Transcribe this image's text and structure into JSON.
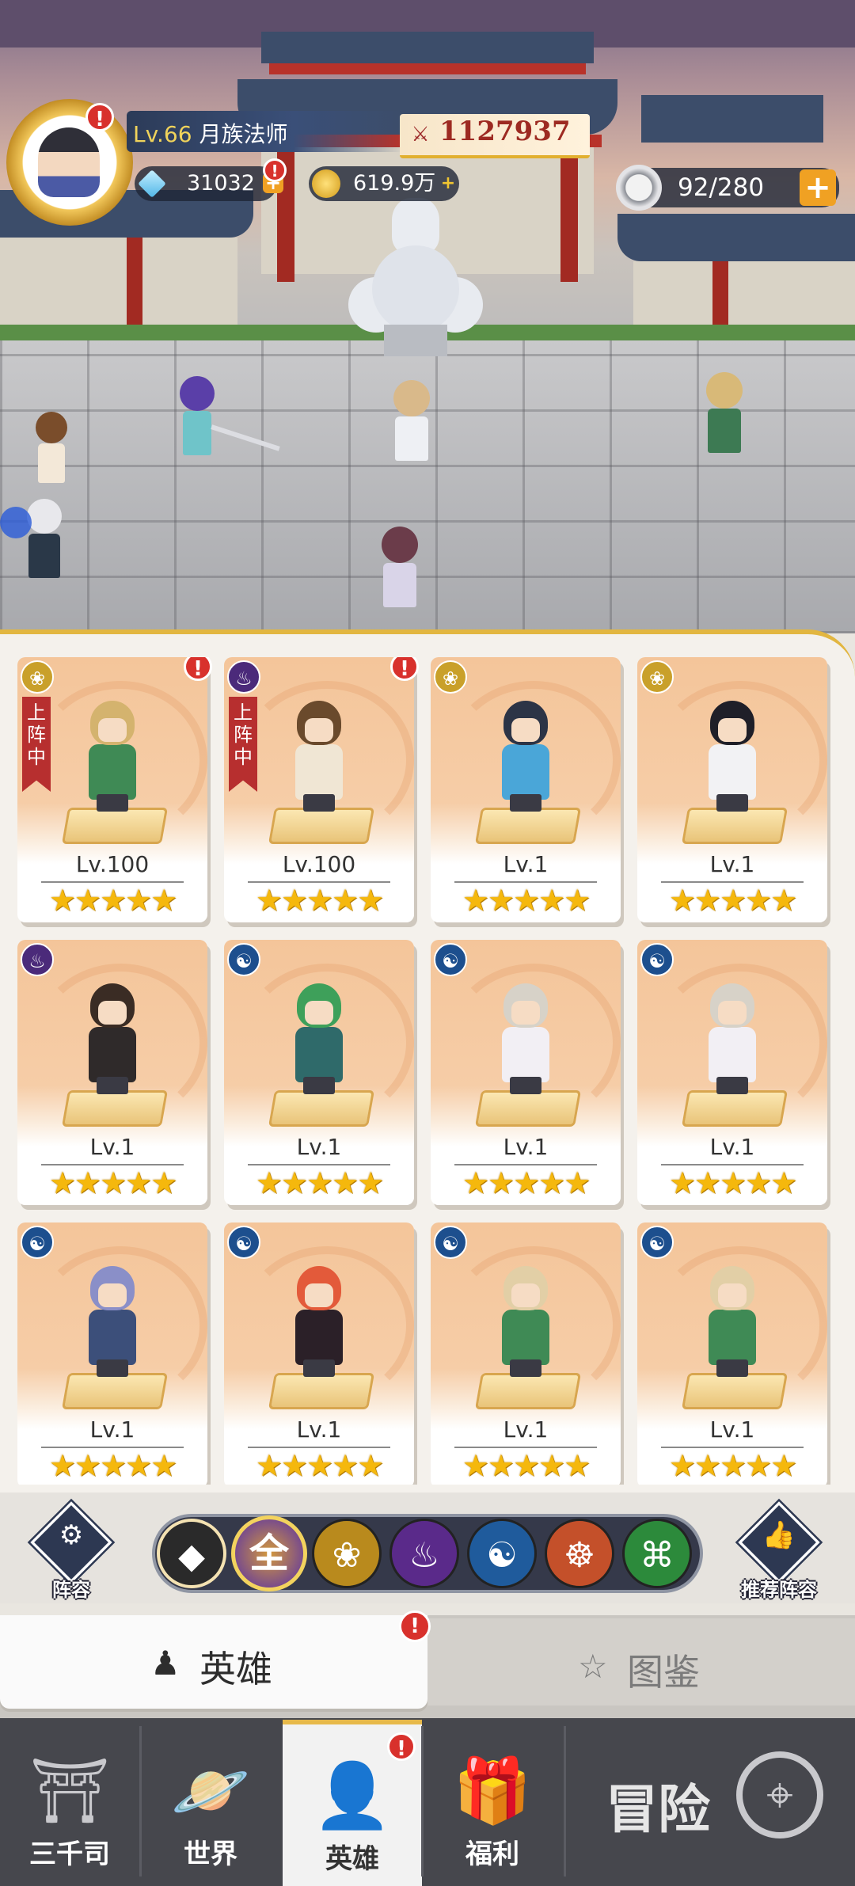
{
  "hud": {
    "level_prefix": "Lv.66",
    "player_name": "月族法师",
    "power": "1127937",
    "gems": "31032",
    "gold": "619.9万",
    "stamina": "92/280",
    "alert_mark": "!"
  },
  "heroes": [
    {
      "level": "Lv.100",
      "stars": "★★★★★",
      "faction": "lotus",
      "faction_glyph": "❀",
      "deployed_label": "上阵中",
      "alert": "!"
    },
    {
      "level": "Lv.100",
      "stars": "★★★★★",
      "faction": "flame",
      "faction_glyph": "♨",
      "deployed_label": "上阵中",
      "alert": "!"
    },
    {
      "level": "Lv.1",
      "stars": "★★★★★",
      "faction": "lotus",
      "faction_glyph": "❀"
    },
    {
      "level": "Lv.1",
      "stars": "★★★★★",
      "faction": "lotus",
      "faction_glyph": "❀"
    },
    {
      "level": "Lv.1",
      "stars": "★★★★★",
      "faction": "flame",
      "faction_glyph": "♨"
    },
    {
      "level": "Lv.1",
      "stars": "★★★★★",
      "faction": "yinyang",
      "faction_glyph": "☯"
    },
    {
      "level": "Lv.1",
      "stars": "★★★★★",
      "faction": "yinyang",
      "faction_glyph": "☯"
    },
    {
      "level": "Lv.1",
      "stars": "★★★★★",
      "faction": "yinyang",
      "faction_glyph": "☯"
    },
    {
      "level": "Lv.1",
      "stars": "★★★★★",
      "faction": "yinyang",
      "faction_glyph": "☯"
    },
    {
      "level": "Lv.1",
      "stars": "★★★★★",
      "faction": "yinyang",
      "faction_glyph": "☯"
    },
    {
      "level": "Lv.1",
      "stars": "★★★★★",
      "faction": "yinyang",
      "faction_glyph": "☯"
    },
    {
      "level": "Lv.1",
      "stars": "★★★★★",
      "faction": "yinyang",
      "faction_glyph": "☯"
    }
  ],
  "filter_bar": {
    "formation_label": "阵容",
    "recommended_label": "推荐阵容",
    "filters": [
      {
        "key": "rarity",
        "glyph": "◆",
        "color": "#2a2a2a"
      },
      {
        "key": "all",
        "glyph": "全",
        "color": "#c07b2a",
        "selected": true
      },
      {
        "key": "lotus",
        "glyph": "❀",
        "color": "#b98a1d"
      },
      {
        "key": "flame",
        "glyph": "♨",
        "color": "#5a2a8a"
      },
      {
        "key": "yinyang",
        "glyph": "☯",
        "color": "#1f5b9c"
      },
      {
        "key": "meditation",
        "glyph": "☸",
        "color": "#c4502a"
      },
      {
        "key": "helix",
        "glyph": "⌘",
        "color": "#2c8a3b"
      }
    ]
  },
  "tabs": {
    "heroes_label": "英雄",
    "gallery_label": "图鉴"
  },
  "bottom_nav": {
    "items": [
      {
        "label": "三千司",
        "icon": "temple-icon"
      },
      {
        "label": "世界",
        "icon": "planet-icon"
      },
      {
        "label": "英雄",
        "icon": "hero-icon",
        "active": true
      },
      {
        "label": "福利",
        "icon": "gift-box-icon"
      }
    ],
    "adventure_label": "冒险"
  },
  "colors": {
    "accent_gold": "#e2b640",
    "alert_red": "#d8312c",
    "star_yellow": "#f5b80d",
    "nav_dark": "#46474d"
  }
}
